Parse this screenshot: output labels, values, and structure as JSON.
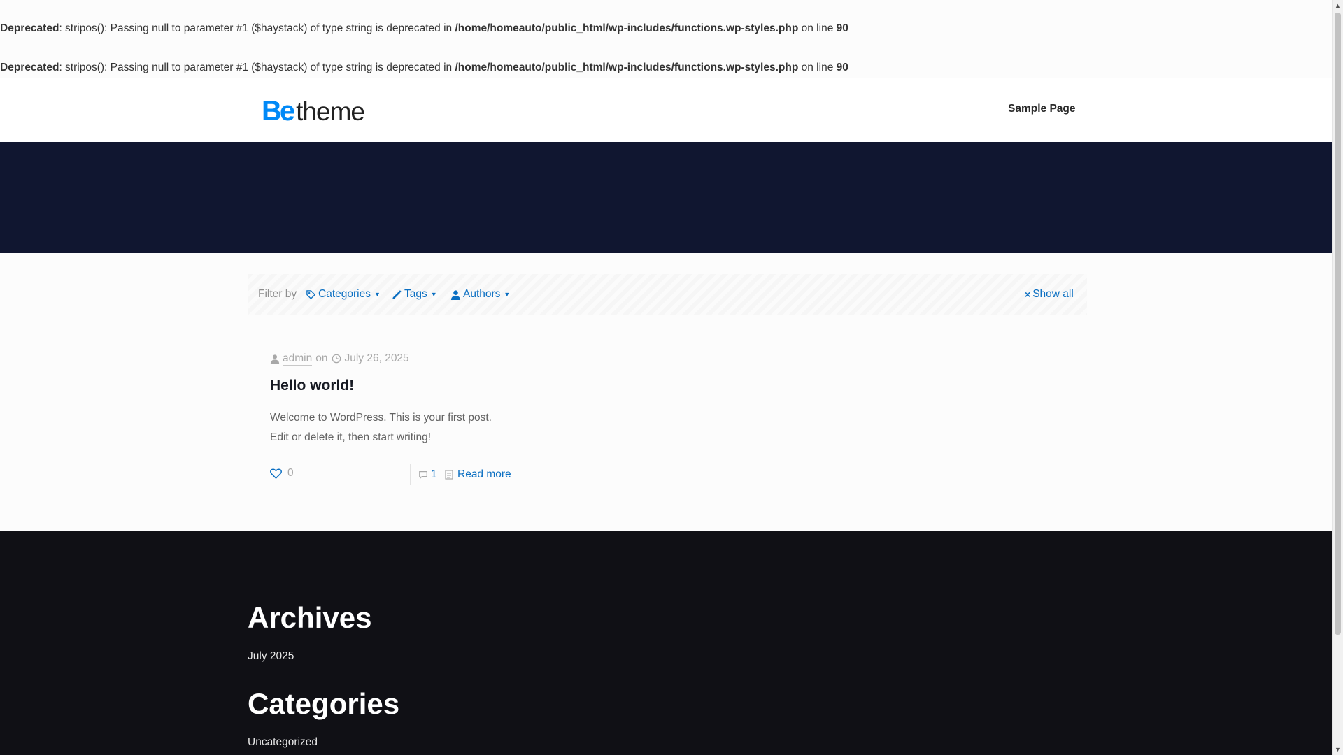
{
  "notices": [
    {
      "level": "Deprecated",
      "message": ": stripos(): Passing null to parameter #1 ($haystack) of type string is deprecated in ",
      "file": "/home/homeauto/public_html/wp-includes/functions.wp-styles.php",
      "online": " on line ",
      "line": "90"
    },
    {
      "level": "Deprecated",
      "message": ": stripos(): Passing null to parameter #1 ($haystack) of type string is deprecated in ",
      "file": "/home/homeauto/public_html/wp-includes/functions.wp-styles.php",
      "online": " on line ",
      "line": "90"
    }
  ],
  "header": {
    "logo_be": "Be",
    "logo_theme": "theme",
    "nav": [
      {
        "label": "Sample Page"
      }
    ]
  },
  "filters": {
    "label": "Filter by",
    "categories": "Categories",
    "tags": "Tags",
    "authors": "Authors",
    "show_all": "Show all"
  },
  "post": {
    "author": "admin",
    "on": "on",
    "date": "July 26, 2025",
    "title": "Hello world!",
    "excerpt_line1": "Welcome to WordPress. This is your first post.",
    "excerpt_line2": "Edit or delete it, then start writing!",
    "likes": "0",
    "comments": "1",
    "read_more": "Read more"
  },
  "footer": {
    "archives_title": "Archives",
    "archives": [
      "July 2025"
    ],
    "categories_title": "Categories",
    "categories": [
      "Uncategorized"
    ]
  },
  "colors": {
    "accent": "#0b6fc2",
    "logo_blue": "#0089f7",
    "banner": "#101630",
    "footer": "#101015"
  },
  "icons": {
    "categories": "tag-icon",
    "tags": "pencil-tag-icon",
    "authors": "user-icon",
    "show_all": "close-icon",
    "author_meta": "user-icon",
    "date_meta": "clock-icon",
    "like": "heart-icon",
    "comments": "comment-icon",
    "read_more": "document-icon"
  }
}
